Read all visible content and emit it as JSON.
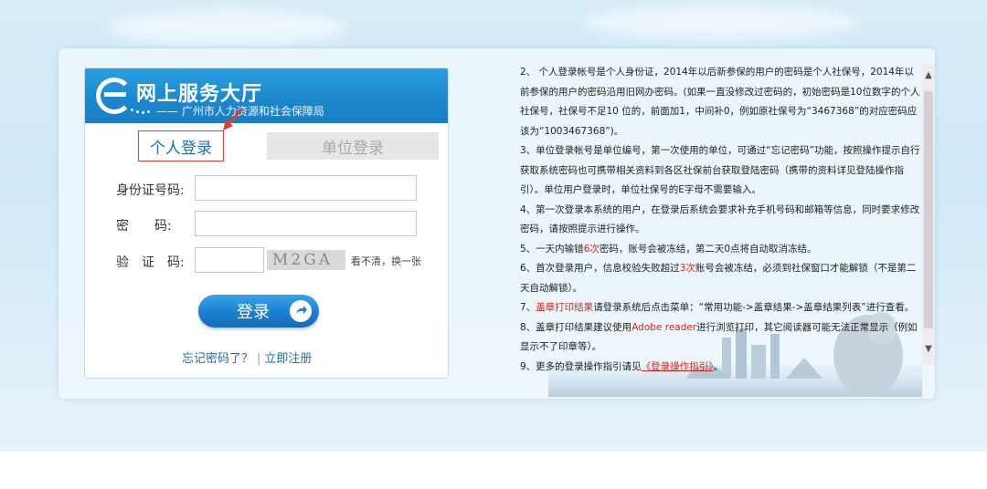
{
  "logo": {
    "title": "网上服务大厅",
    "subtitle": "—— 广州市人力资源和社会保障局"
  },
  "tabs": {
    "personal": "个人登录",
    "unit": "单位登录"
  },
  "form": {
    "id_label": "身份证号码:",
    "password_label": "密　　码:",
    "captcha_label": "验　证　码:",
    "id_value": "",
    "password_value": "",
    "captcha_value": "",
    "captcha_text": "M2GA",
    "captcha_refresh": "看不清，换一张",
    "login_button": "登录",
    "forgot_password": "忘记密码了？",
    "link_separator": "|",
    "register": "立即注册"
  },
  "info": {
    "item2": "2、 个人登录帐号是个人身份证，2014年以后新参保的用户的密码是个人社保号，2014年以前参保的用户的密码沿用旧网办密码。(如果一直没修改过密码的，初始密码是10位数字的个人社保号，社保号不足10 位的，前面加1，中间补0，例如原社保号为“3467368”的对应密码应该为“1003467368”)。",
    "item3": "3、单位登录帐号是单位编号，第一次使用的单位，可通过“忘记密码”功能，按照操作提示自行获取系统密码也可携带相关资料到各区社保前台获取登陆密码（携带的资料详见登陆操作指引）。单位用户登录时，单位社保号的E字母不需要输入。",
    "item4": "4、第一次登录本系统的用户，在登录后系统会要求补充手机号码和邮箱等信息，同时要求修改密码，请按照提示进行操作。",
    "item5_pre": "5、一天内输错",
    "item5_red": "6次",
    "item5_post": "密码，账号会被冻结，第二天0点将自动取消冻结。",
    "item6_pre": "6、首次登录用户，信息校验失败超过",
    "item6_red": "3次",
    "item6_post": "账号会被冻结，必须到社保窗口才能解锁（不是第二天自动解锁）。",
    "item7_pre": "7、",
    "item7_red": "盖章打印结果",
    "item7_post": "请登录系统后点击菜单：“常用功能->盖章结果->盖章结果列表”进行查看。",
    "item8_pre": "8、盖章打印结果建议使用",
    "item8_red": "Adobe reader",
    "item8_post": "进行浏览打印，其它阅读器可能无法正常显示（例如显示不了印章等）。",
    "item9_pre": "9、更多的登录操作指引请见",
    "item9_link": "《登录操作指引》",
    "item9_post": "。"
  },
  "colors": {
    "brand_blue": "#1b87cd",
    "link_blue": "#1c6fb5",
    "highlight_red": "#e0241a"
  }
}
